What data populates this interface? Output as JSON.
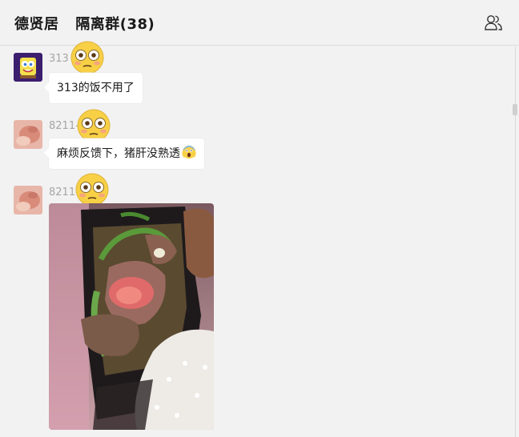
{
  "header": {
    "owner_name": "德贤居",
    "group_name": "隔离群(38)",
    "members_icon": "members-icon"
  },
  "messages": [
    {
      "sender": "313",
      "text": "313的饭不用了",
      "avatar": "spongebob-avatar",
      "emoji": "flushed-face"
    },
    {
      "sender": "8211-",
      "text": "麻烦反馈下，猪肝没熟透",
      "trailing_emoji": "screaming-face",
      "avatar": "photo-avatar",
      "emoji": "flushed-face"
    },
    {
      "sender": "8211-",
      "attachment": "food-photo",
      "avatar": "photo-avatar",
      "emoji": "flushed-face"
    }
  ],
  "colors": {
    "background": "#f2f2f2",
    "bubble": "#ffffff",
    "sender_text": "#a6a6a6",
    "emoji_yellow": "#f7d046"
  }
}
